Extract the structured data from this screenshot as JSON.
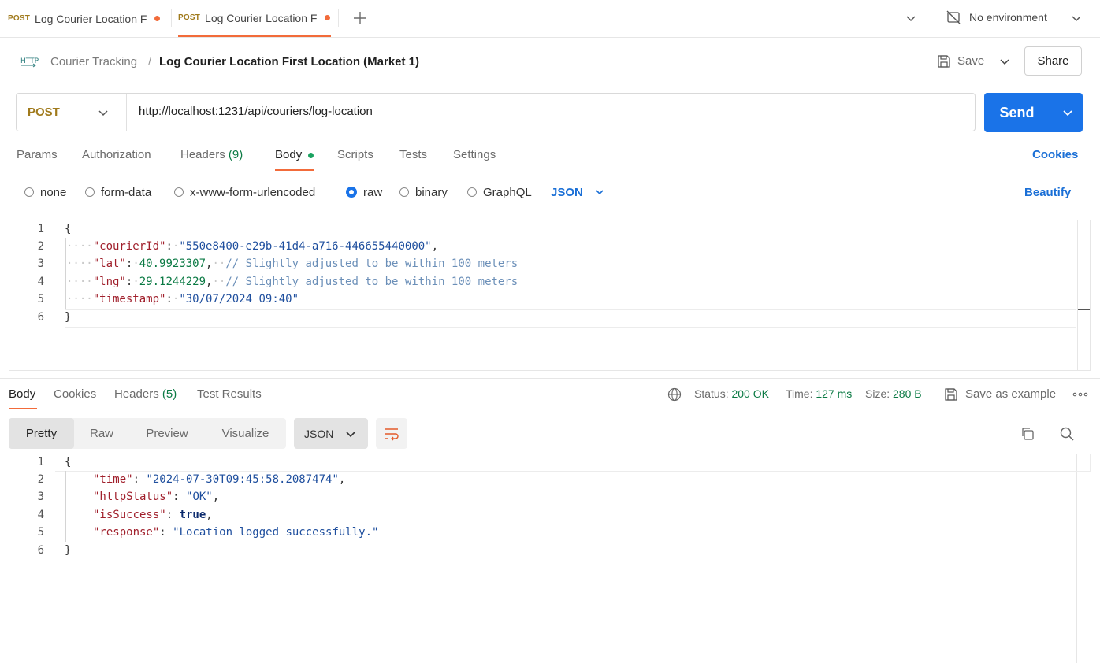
{
  "tabs": [
    {
      "method": "POST",
      "title": "Log Courier Location F"
    },
    {
      "method": "POST",
      "title": "Log Courier Location F"
    }
  ],
  "environment": {
    "label": "No environment"
  },
  "breadcrumb": {
    "icon_text": "HTTP",
    "collection": "Courier Tracking",
    "separator": "/",
    "request_name": "Log Courier Location First Location (Market 1)"
  },
  "toolbar": {
    "save_label": "Save",
    "share_label": "Share"
  },
  "request": {
    "method": "POST",
    "url": "http://localhost:1231/api/couriers/log-location",
    "send_label": "Send"
  },
  "request_tabs": {
    "params": "Params",
    "authorization": "Authorization",
    "headers": "Headers",
    "headers_count": "(9)",
    "body": "Body",
    "scripts": "Scripts",
    "tests": "Tests",
    "settings": "Settings",
    "cookies": "Cookies"
  },
  "body_types": {
    "none": "none",
    "form_data": "form-data",
    "urlencoded": "x-www-form-urlencoded",
    "raw": "raw",
    "binary": "binary",
    "graphql": "GraphQL",
    "format": "JSON",
    "beautify": "Beautify",
    "selected": "raw"
  },
  "request_body": {
    "line_numbers": [
      "1",
      "2",
      "3",
      "4",
      "5",
      "6"
    ],
    "open_brace": "{",
    "close_brace": "}",
    "courierId_key": "\"courierId\"",
    "courierId_value": "\"550e8400-e29b-41d4-a716-446655440000\"",
    "lat_key": "\"lat\"",
    "lat_value": "40.9923307",
    "lng_key": "\"lng\"",
    "lng_value": "29.1244229",
    "comment": "// Slightly adjusted to be within 100 meters",
    "timestamp_key": "\"timestamp\"",
    "timestamp_value": "\"30/07/2024 09:40\""
  },
  "response_tabs": {
    "body": "Body",
    "cookies": "Cookies",
    "headers": "Headers",
    "headers_count": "(5)",
    "test_results": "Test Results"
  },
  "response_meta": {
    "status_label": "Status:",
    "status_value": "200 OK",
    "time_label": "Time:",
    "time_value": "127 ms",
    "size_label": "Size:",
    "size_value": "280 B",
    "save_example": "Save as example"
  },
  "response_views": {
    "pretty": "Pretty",
    "raw": "Raw",
    "preview": "Preview",
    "visualize": "Visualize",
    "format": "JSON"
  },
  "response_body": {
    "line_numbers": [
      "1",
      "2",
      "3",
      "4",
      "5",
      "6"
    ],
    "open_brace": "{",
    "close_brace": "}",
    "time_key": "\"time\"",
    "time_value": "\"2024-07-30T09:45:58.2087474\"",
    "httpStatus_key": "\"httpStatus\"",
    "httpStatus_value": "\"OK\"",
    "isSuccess_key": "\"isSuccess\"",
    "isSuccess_value": "true",
    "response_key": "\"response\"",
    "response_value": "\"Location logged successfully.\""
  },
  "colors": {
    "accent_blue": "#1a73e8",
    "tab_orange": "#f26b3a",
    "success_green": "#0b7a44",
    "body_dot_green": "#1aa260"
  }
}
